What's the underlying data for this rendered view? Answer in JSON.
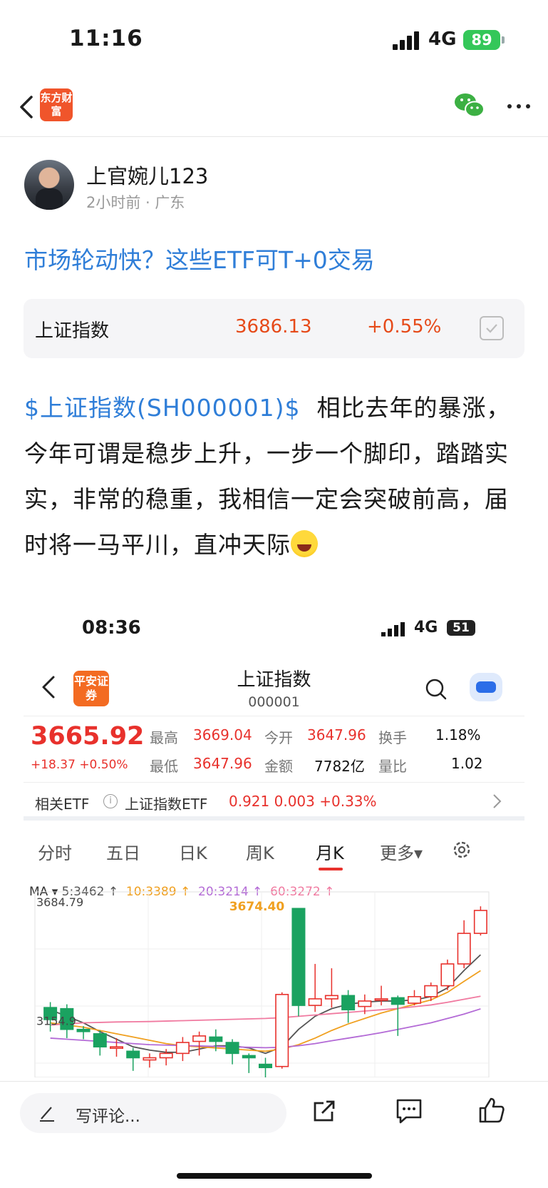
{
  "status_bar": {
    "time": "11:16",
    "network": "4G",
    "battery": "89"
  },
  "nav": {
    "app_logo_text": "东方财富"
  },
  "author": {
    "name": "上官婉儿123",
    "meta": "2小时前 · 广东"
  },
  "post": {
    "title": "市场轮动快？这些ETF可T+0交易",
    "link": "$上证指数(SH000001)$",
    "body": "相比去年的暴涨，今年可谓是稳步上升，一步一个脚印，踏踏实实，非常的稳重，我相信一定会突破前高，届时将一马平川，直冲天际"
  },
  "stock_card": {
    "name": "上证指数",
    "price": "3686.13",
    "change": "+0.55%"
  },
  "screenshot": {
    "status": {
      "time": "08:36",
      "network": "4G",
      "battery": "51"
    },
    "logo_text": "平安证券",
    "title": "上证指数",
    "code": "000001",
    "price": "3665.92",
    "change": "+18.37 +0.50%",
    "quote": {
      "high_label": "最高",
      "high": "3669.04",
      "open_label": "今开",
      "open": "3647.96",
      "turnover_label": "换手",
      "turnover": "1.18%",
      "low_label": "最低",
      "low": "3647.96",
      "amount_label": "金额",
      "amount": "7782亿",
      "ratio_label": "量比",
      "ratio": "1.02"
    },
    "etf": {
      "label": "相关ETF",
      "name": "上证指数ETF",
      "values": "0.921  0.003  +0.33%"
    },
    "tabs": [
      "分时",
      "五日",
      "日K",
      "周K",
      "月K",
      "更多▾"
    ],
    "ma": {
      "label": "MA ▾",
      "ma5": "5:3462 ↑",
      "ma10": "10:3389 ↑",
      "ma20": "20:3214 ↑",
      "ma60": "60:3272 ↑",
      "ma5_color": "#555555",
      "ma10_color": "#f0a020",
      "ma20_color": "#b36ad6",
      "ma60_color": "#f07aa0"
    },
    "chart_labels": {
      "max_axis": "3684.79",
      "peak": "3674.40",
      "mid_axis": "3154.9"
    }
  },
  "chart_data": {
    "type": "candlestick",
    "title": "上证指数 月K",
    "ylim": [
      2900,
      3750
    ],
    "candles": [
      {
        "o": 3220,
        "c": 3165,
        "h": 3245,
        "l": 3110,
        "dir": "down"
      },
      {
        "o": 3215,
        "c": 3120,
        "h": 3235,
        "l": 3080,
        "dir": "down"
      },
      {
        "o": 3120,
        "c": 3110,
        "h": 3135,
        "l": 3075,
        "dir": "down"
      },
      {
        "o": 3100,
        "c": 3040,
        "h": 3115,
        "l": 3000,
        "dir": "down"
      },
      {
        "o": 3040,
        "c": 3040,
        "h": 3080,
        "l": 2995,
        "dir": "doji"
      },
      {
        "o": 3020,
        "c": 2990,
        "h": 3035,
        "l": 2930,
        "dir": "down"
      },
      {
        "o": 2980,
        "c": 2990,
        "h": 3010,
        "l": 2945,
        "dir": "up"
      },
      {
        "o": 2990,
        "c": 3010,
        "h": 3030,
        "l": 2955,
        "dir": "up"
      },
      {
        "o": 3010,
        "c": 3060,
        "h": 3085,
        "l": 2975,
        "dir": "up"
      },
      {
        "o": 3065,
        "c": 3090,
        "h": 3110,
        "l": 3000,
        "dir": "up"
      },
      {
        "o": 3085,
        "c": 3065,
        "h": 3120,
        "l": 3020,
        "dir": "down"
      },
      {
        "o": 3060,
        "c": 3010,
        "h": 3075,
        "l": 2960,
        "dir": "down"
      },
      {
        "o": 3000,
        "c": 2990,
        "h": 3010,
        "l": 2920,
        "dir": "down"
      },
      {
        "o": 2960,
        "c": 2945,
        "h": 2990,
        "l": 2900,
        "dir": "down"
      },
      {
        "o": 2950,
        "c": 3280,
        "h": 3290,
        "l": 2940,
        "dir": "up"
      },
      {
        "o": 3674,
        "c": 3230,
        "h": 3674,
        "l": 3180,
        "dir": "down"
      },
      {
        "o": 3230,
        "c": 3260,
        "h": 3420,
        "l": 3200,
        "dir": "up"
      },
      {
        "o": 3260,
        "c": 3275,
        "h": 3400,
        "l": 3220,
        "dir": "up"
      },
      {
        "o": 3275,
        "c": 3210,
        "h": 3300,
        "l": 3150,
        "dir": "down"
      },
      {
        "o": 3225,
        "c": 3250,
        "h": 3280,
        "l": 3190,
        "dir": "up"
      },
      {
        "o": 3255,
        "c": 3260,
        "h": 3320,
        "l": 3230,
        "dir": "up"
      },
      {
        "o": 3265,
        "c": 3235,
        "h": 3275,
        "l": 3090,
        "dir": "down"
      },
      {
        "o": 3240,
        "c": 3270,
        "h": 3300,
        "l": 3230,
        "dir": "up"
      },
      {
        "o": 3270,
        "c": 3320,
        "h": 3335,
        "l": 3250,
        "dir": "up"
      },
      {
        "o": 3320,
        "c": 3420,
        "h": 3440,
        "l": 3300,
        "dir": "up"
      },
      {
        "o": 3420,
        "c": 3560,
        "h": 3620,
        "l": 3400,
        "dir": "up"
      },
      {
        "o": 3560,
        "c": 3665,
        "h": 3684,
        "l": 3550,
        "dir": "up"
      }
    ],
    "ma_series": [
      {
        "name": "MA5",
        "values": [
          3210,
          3180,
          3150,
          3110,
          3075,
          3040,
          3025,
          3015,
          3015,
          3030,
          3045,
          3045,
          3035,
          3010,
          3040,
          3120,
          3180,
          3215,
          3235,
          3245,
          3250,
          3250,
          3255,
          3270,
          3310,
          3390,
          3462
        ]
      },
      {
        "name": "MA10",
        "values": [
          3150,
          3140,
          3130,
          3115,
          3100,
          3085,
          3070,
          3055,
          3045,
          3040,
          3035,
          3030,
          3025,
          3020,
          3030,
          3050,
          3080,
          3115,
          3145,
          3170,
          3195,
          3215,
          3235,
          3255,
          3290,
          3340,
          3389
        ]
      },
      {
        "name": "MA20",
        "values": [
          3080,
          3075,
          3070,
          3065,
          3060,
          3055,
          3050,
          3048,
          3046,
          3044,
          3042,
          3040,
          3038,
          3036,
          3038,
          3045,
          3055,
          3068,
          3080,
          3092,
          3105,
          3120,
          3135,
          3150,
          3170,
          3190,
          3214
        ]
      },
      {
        "name": "MA60",
        "values": [
          3140,
          3145,
          3150,
          3152,
          3154,
          3155,
          3156,
          3158,
          3160,
          3162,
          3164,
          3166,
          3168,
          3170,
          3174,
          3180,
          3186,
          3192,
          3198,
          3204,
          3210,
          3216,
          3224,
          3232,
          3244,
          3258,
          3272
        ]
      }
    ]
  }
}
